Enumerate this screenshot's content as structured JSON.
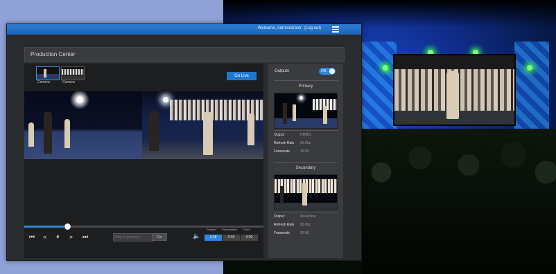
{
  "window": {
    "welcome_text": "Welcome, Administrator",
    "logout_text": "(Log out)",
    "section_title": "Production Center"
  },
  "sources": {
    "items": [
      {
        "label": "Camera"
      },
      {
        "label": "Camera"
      }
    ],
    "go_live_label": "Go Live"
  },
  "player": {
    "progress": 0.18,
    "skip_placeholder": "Skip to (mm:ss)",
    "go_label": "Go",
    "segment_headers": [
      "Paused",
      "Presentation",
      "Cloud"
    ],
    "segments": [
      "1:18",
      "0:00",
      "0:00"
    ],
    "active_segment": 0
  },
  "outputs": {
    "label": "Outputs",
    "toggle_label": "ON",
    "primary": {
      "title": "Primary",
      "rows": [
        {
          "key": "Output",
          "value": "HDMI3"
        },
        {
          "key": "Refresh Rate",
          "value": "60.0hz"
        },
        {
          "key": "Framerate",
          "value": "30.00"
        }
      ]
    },
    "secondary": {
      "title": "Secondary",
      "rows": [
        {
          "key": "Output",
          "value": "Not Active"
        },
        {
          "key": "Refresh Rate",
          "value": "60.0hz"
        },
        {
          "key": "Framerate",
          "value": "30.00"
        }
      ]
    }
  }
}
